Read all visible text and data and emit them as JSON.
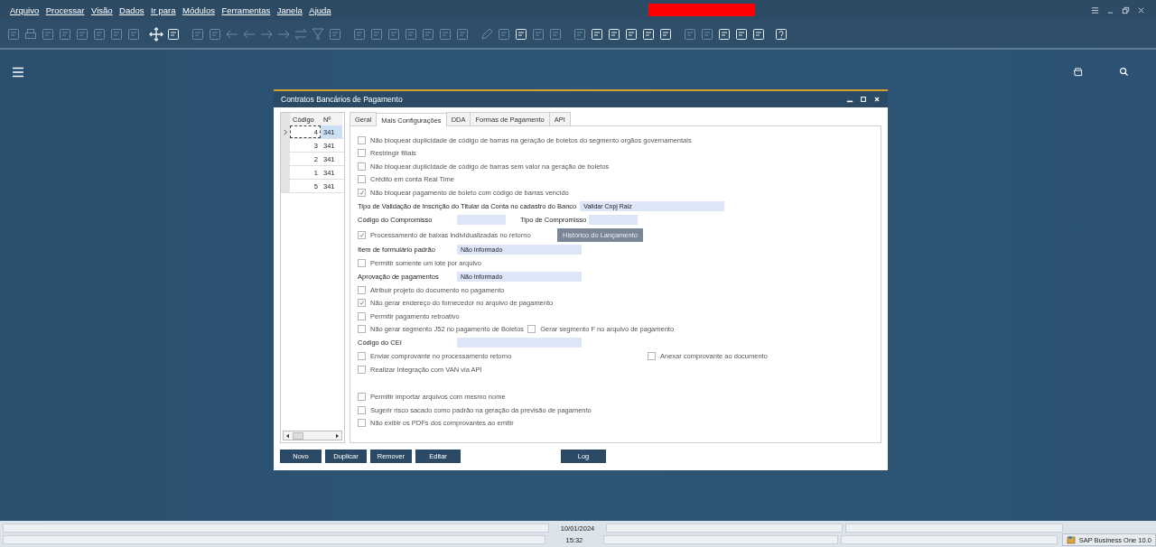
{
  "menu": [
    {
      "label": "Arquivo"
    },
    {
      "label": "Processar"
    },
    {
      "label": "Visão"
    },
    {
      "label": "Dados"
    },
    {
      "label": "Ir para"
    },
    {
      "label": "Módulos"
    },
    {
      "label": "Ferramentas"
    },
    {
      "label": "Janela"
    },
    {
      "label": "Ajuda"
    }
  ],
  "dialog": {
    "title": "Contratos Bancários de Pagamento",
    "grid": {
      "columns": [
        "Código",
        "Nº"
      ],
      "rows": [
        {
          "code": "4",
          "number": "341",
          "selected": true
        },
        {
          "code": "3",
          "number": "341",
          "selected": false
        },
        {
          "code": "2",
          "number": "341",
          "selected": false
        },
        {
          "code": "1",
          "number": "341",
          "selected": false
        },
        {
          "code": "5",
          "number": "341",
          "selected": false
        }
      ]
    },
    "tabs": [
      {
        "label": "Geral",
        "selected": false
      },
      {
        "label": "Mais Configurações",
        "selected": true
      },
      {
        "label": "DDA",
        "selected": false
      },
      {
        "label": "Formas de Pagamento",
        "selected": false
      },
      {
        "label": "API",
        "selected": false
      }
    ],
    "items": [
      {
        "kind": "checkbox",
        "label": "Não bloquear duplicidade de código de barras na geração de boletos do segmento orgãos governamentais",
        "checked": false
      },
      {
        "kind": "checkbox",
        "label": "Restringir filiais",
        "checked": false
      },
      {
        "kind": "checkbox",
        "label": "Não bloquear duplicidade de código de barras sem valor  na geração de boletos",
        "checked": false
      },
      {
        "kind": "checkbox",
        "label": "Crédito em conta Real Time",
        "checked": false
      },
      {
        "kind": "checkbox",
        "label": "Não bloquear pagamento de boleto com código de barras vencido",
        "checked": true
      },
      {
        "kind": "field",
        "label": "Tipo de Validação de Inscrição do Titular da Conta no cadastro do Banco",
        "value": "Validar Cnpj Raiz",
        "wide": true
      },
      {
        "kind": "field_pair",
        "label": "Código do Compromisso",
        "label_2": "Tipo de Compromisso"
      },
      {
        "kind": "checkbox_button",
        "label": "Processamento de baixas  individualizadas no retorno",
        "checked": true,
        "button": "Histórico do Lançamento"
      },
      {
        "kind": "field",
        "label": "Item de formulário padrão",
        "value": "Não Informado",
        "wide": false
      },
      {
        "kind": "checkbox",
        "label": "Permitir somente um lote por arquivo",
        "checked": false
      },
      {
        "kind": "field",
        "label": "Aprovação de pagamentos",
        "value": "Não Informado",
        "wide": false
      },
      {
        "kind": "checkbox",
        "label": "Atribuir projeto do documento no pagamento",
        "checked": false
      },
      {
        "kind": "checkbox",
        "label": "Não gerar endereço do fornecedor no arquivo de pagamento",
        "checked": true
      },
      {
        "kind": "checkbox",
        "label": "Permitir pagamento retroativo",
        "checked": false
      },
      {
        "kind": "checkbox_row",
        "boxes": [
          {
            "label": "Não gerar segmento J52 no pagamento de  Boletos",
            "checked": false
          },
          {
            "label": "Gerar segmento F no arquivo de pagamento",
            "checked": false
          }
        ]
      },
      {
        "kind": "field",
        "label": "Código do CEI",
        "wide": false
      },
      {
        "kind": "checkbox_split",
        "boxes": [
          {
            "label": "Enviar comprovante no processamento retorno",
            "checked": false
          },
          {
            "label": "Anexar comprovante ao documento",
            "checked": false
          }
        ]
      },
      {
        "kind": "checkbox",
        "label": "Realizar Integração com VAN via API",
        "checked": false
      },
      {
        "kind": "gap"
      },
      {
        "kind": "checkbox",
        "label": "Permitir importar arquivos com mesmo nome",
        "checked": false
      },
      {
        "kind": "checkbox",
        "label": "Sugerir risco sacado como padrão na geração da previsão de pagamento",
        "checked": false
      },
      {
        "kind": "checkbox",
        "label": "Não exibir os PDFs dos comprovantes ao emitir",
        "checked": false
      }
    ],
    "buttons": [
      {
        "label": "Novo"
      },
      {
        "label": "Duplicar"
      },
      {
        "label": "Remover"
      },
      {
        "label": "Editar"
      }
    ],
    "log_button": "Log"
  },
  "status_bar": {
    "date": "10/01/2024",
    "time": "15:32"
  },
  "taskbar_item": "SAP Business One 10.0"
}
